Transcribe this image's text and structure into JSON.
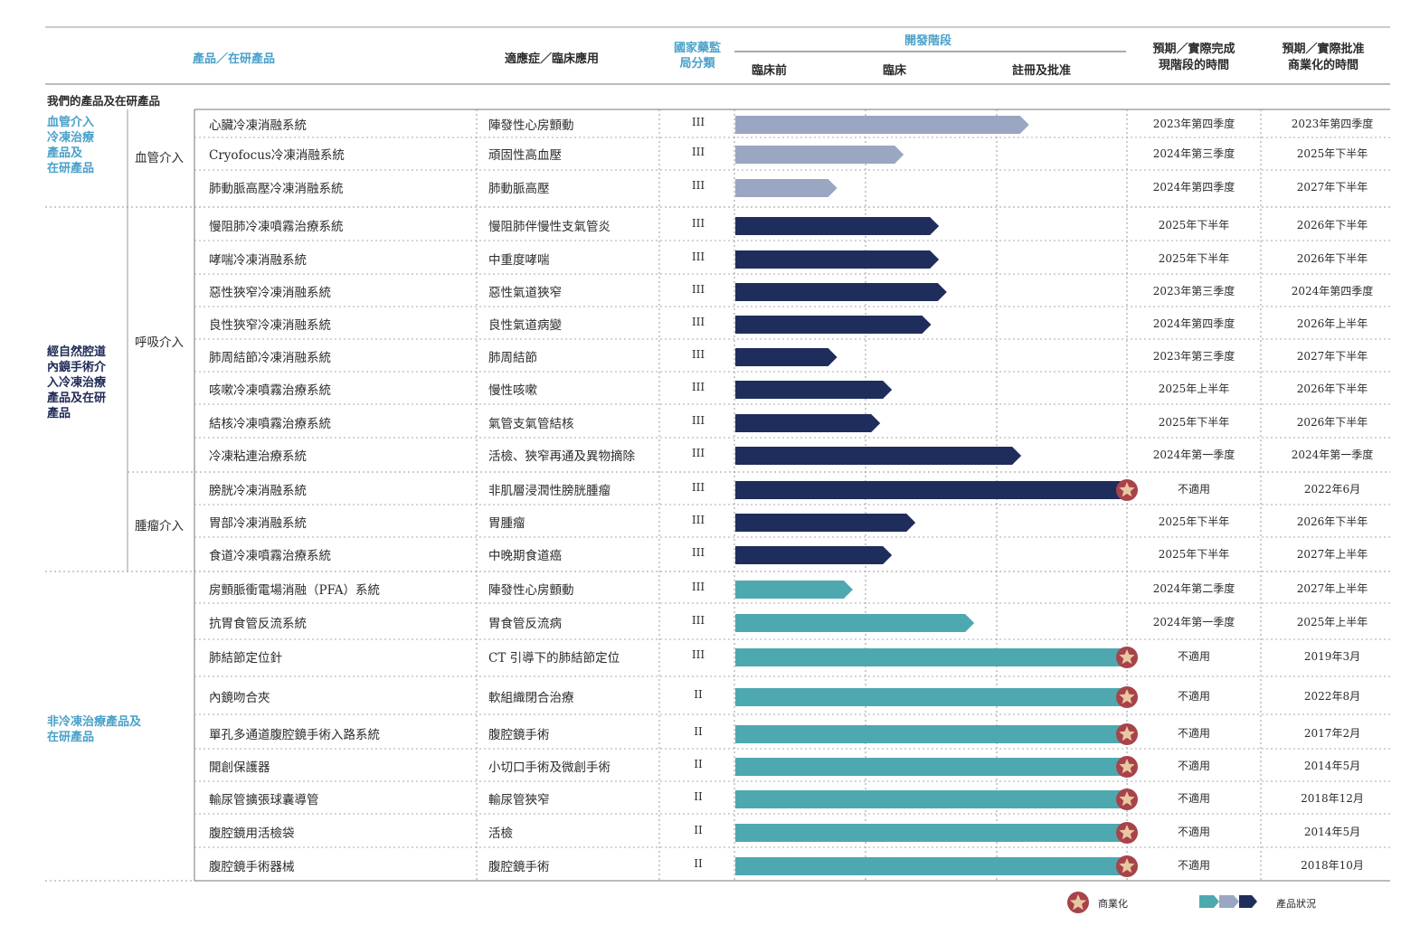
{
  "header": {
    "product": "產品／在研產品",
    "indication": "適應症／臨床應用",
    "nmpa": "國家藥監局分類",
    "dev_stage": "開發階段",
    "stage_preclinical": "臨床前",
    "stage_clinical": "臨床",
    "stage_registration": "註冊及批准",
    "expected_stage_time": "預期／實際完成\n現階段的時間",
    "expected_approval_time": "預期／實際批准\n商業化的時間"
  },
  "section_title": "我們的產品及在研產品",
  "groups": [
    {
      "label": "血管介入\n冷凍治療\n產品及\n在研產品",
      "color": "#4aa0c9"
    },
    {
      "label": "經自然腔道\n內鏡手術介\n入冷凍治療\n產品及在研\n產品",
      "color": "#1e2a55"
    },
    {
      "label": "非冷凍治療產品及\n在研產品",
      "color": "#4aa0c9"
    }
  ],
  "subgroups": [
    "血管介入",
    "呼吸介入",
    "腫瘤介入"
  ],
  "legend": {
    "commercialized": "商業化",
    "status": "產品狀況",
    "colors": [
      "#4ea8b0",
      "#9aa6c2",
      "#1e2d5c"
    ]
  },
  "chart_data": {
    "type": "bar",
    "categories": [
      "臨床前",
      "臨床",
      "註冊及批准"
    ],
    "rows": [
      {
        "product": "心臟冷凍消融系統",
        "indication": "陣發性心房顫動",
        "class": "III",
        "progress": 0.75,
        "color": "#9aa6c2",
        "commercial": false,
        "stage_time": "2023年第四季度",
        "approval_time": "2023年第四季度"
      },
      {
        "product": "Cryofocus冷凍消融系統",
        "indication": "頑固性高血壓",
        "class": "III",
        "progress": 0.43,
        "color": "#9aa6c2",
        "commercial": false,
        "stage_time": "2024年第三季度",
        "approval_time": "2025年下半年"
      },
      {
        "product": "肺動脈高壓冷凍消融系統",
        "indication": "肺動脈高壓",
        "class": "III",
        "progress": 0.26,
        "color": "#9aa6c2",
        "commercial": false,
        "stage_time": "2024年第四季度",
        "approval_time": "2027年下半年"
      },
      {
        "product": "慢阻肺冷凍噴霧治療系統",
        "indication": "慢阻肺伴慢性支氣管炎",
        "class": "III",
        "progress": 0.52,
        "color": "#1e2d5c",
        "commercial": false,
        "stage_time": "2025年下半年",
        "approval_time": "2026年下半年"
      },
      {
        "product": "哮喘冷凍消融系統",
        "indication": "中重度哮喘",
        "class": "III",
        "progress": 0.52,
        "color": "#1e2d5c",
        "commercial": false,
        "stage_time": "2025年下半年",
        "approval_time": "2026年下半年"
      },
      {
        "product": "惡性狹窄冷凍消融系統",
        "indication": "惡性氣道狹窄",
        "class": "III",
        "progress": 0.54,
        "color": "#1e2d5c",
        "commercial": false,
        "stage_time": "2023年第三季度",
        "approval_time": "2024年第四季度"
      },
      {
        "product": "良性狹窄冷凍消融系統",
        "indication": "良性氣道病變",
        "class": "III",
        "progress": 0.5,
        "color": "#1e2d5c",
        "commercial": false,
        "stage_time": "2024年第四季度",
        "approval_time": "2026年上半年"
      },
      {
        "product": "肺周結節冷凍消融系統",
        "indication": "肺周結節",
        "class": "III",
        "progress": 0.26,
        "color": "#1e2d5c",
        "commercial": false,
        "stage_time": "2023年第三季度",
        "approval_time": "2027年下半年"
      },
      {
        "product": "咳嗽冷凍噴霧治療系統",
        "indication": "慢性咳嗽",
        "class": "III",
        "progress": 0.4,
        "color": "#1e2d5c",
        "commercial": false,
        "stage_time": "2025年上半年",
        "approval_time": "2026年下半年"
      },
      {
        "product": "結核冷凍噴霧治療系統",
        "indication": "氣管支氣管結核",
        "class": "III",
        "progress": 0.37,
        "color": "#1e2d5c",
        "commercial": false,
        "stage_time": "2025年下半年",
        "approval_time": "2026年下半年"
      },
      {
        "product": "冷凍粘連治療系統",
        "indication": "活檢、狹窄再通及異物摘除",
        "class": "III",
        "progress": 0.73,
        "color": "#1e2d5c",
        "commercial": false,
        "stage_time": "2024年第一季度",
        "approval_time": "2024年第一季度"
      },
      {
        "product": "膀胱冷凍消融系統",
        "indication": "非肌層浸潤性膀胱腫瘤",
        "class": "III",
        "progress": 1.0,
        "color": "#1e2d5c",
        "commercial": true,
        "stage_time": "不適用",
        "approval_time": "2022年6月"
      },
      {
        "product": "胃部冷凍消融系統",
        "indication": "胃腫瘤",
        "class": "III",
        "progress": 0.46,
        "color": "#1e2d5c",
        "commercial": false,
        "stage_time": "2025年下半年",
        "approval_time": "2026年下半年"
      },
      {
        "product": "食道冷凍噴霧治療系統",
        "indication": "中晚期食道癌",
        "class": "III",
        "progress": 0.4,
        "color": "#1e2d5c",
        "commercial": false,
        "stage_time": "2025年下半年",
        "approval_time": "2027年上半年"
      },
      {
        "product": "房顫脈衝電場消融（PFA）系統",
        "indication": "陣發性心房顫動",
        "class": "III",
        "progress": 0.3,
        "color": "#4ea8b0",
        "commercial": false,
        "stage_time": "2024年第二季度",
        "approval_time": "2027年上半年"
      },
      {
        "product": "抗胃食管反流系統",
        "indication": "胃食管反流病",
        "class": "III",
        "progress": 0.61,
        "color": "#4ea8b0",
        "commercial": false,
        "stage_time": "2024年第一季度",
        "approval_time": "2025年上半年"
      },
      {
        "product": "肺結節定位針",
        "indication": "CT 引導下的肺結節定位",
        "class": "III",
        "progress": 1.0,
        "color": "#4ea8b0",
        "commercial": true,
        "stage_time": "不適用",
        "approval_time": "2019年3月"
      },
      {
        "product": "內鏡吻合夾",
        "indication": "軟組織閉合治療",
        "class": "II",
        "progress": 1.0,
        "color": "#4ea8b0",
        "commercial": true,
        "stage_time": "不適用",
        "approval_time": "2022年8月"
      },
      {
        "product": "單孔多通道腹腔鏡手術入路系統",
        "indication": "腹腔鏡手術",
        "class": "II",
        "progress": 1.0,
        "color": "#4ea8b0",
        "commercial": true,
        "stage_time": "不適用",
        "approval_time": "2017年2月"
      },
      {
        "product": "開創保護器",
        "indication": "小切口手術及微創手術",
        "class": "II",
        "progress": 1.0,
        "color": "#4ea8b0",
        "commercial": true,
        "stage_time": "不適用",
        "approval_time": "2014年5月"
      },
      {
        "product": "輸尿管擴張球囊導管",
        "indication": "輸尿管狹窄",
        "class": "II",
        "progress": 1.0,
        "color": "#4ea8b0",
        "commercial": true,
        "stage_time": "不適用",
        "approval_time": "2018年12月"
      },
      {
        "product": "腹腔鏡用活檢袋",
        "indication": "活檢",
        "class": "II",
        "progress": 1.0,
        "color": "#4ea8b0",
        "commercial": true,
        "stage_time": "不適用",
        "approval_time": "2014年5月"
      },
      {
        "product": "腹腔鏡手術器械",
        "indication": "腹腔鏡手術",
        "class": "II",
        "progress": 1.0,
        "color": "#4ea8b0",
        "commercial": true,
        "stage_time": "不適用",
        "approval_time": "2018年10月"
      }
    ]
  }
}
